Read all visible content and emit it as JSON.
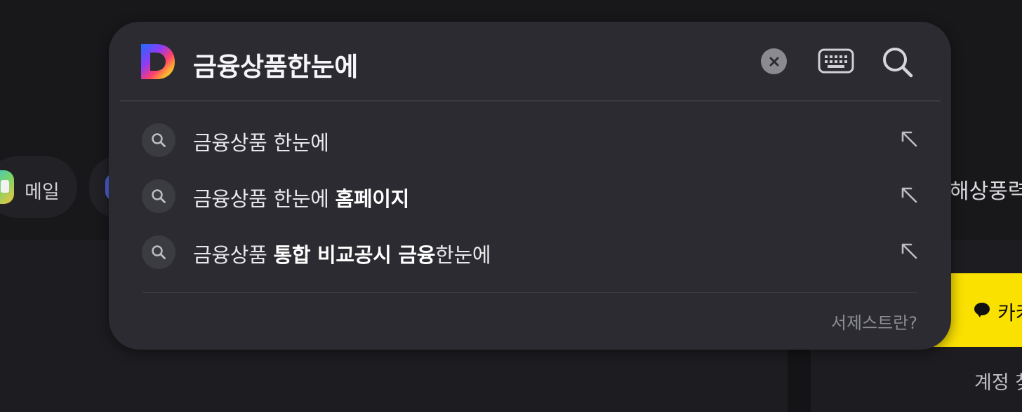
{
  "background": {
    "shortcuts": [
      {
        "label": "메일",
        "icon": "mail-app-icon"
      },
      {
        "label": "",
        "icon": "cafe-app-icon"
      }
    ],
    "right_heading": "해상풍력",
    "kakao_button_label": "카카",
    "account_label": "계정 찾"
  },
  "search": {
    "logo": "daum-logo-icon",
    "query": "금융상품한눈에",
    "clear_icon": "clear-icon",
    "keyboard_icon": "keyboard-icon",
    "search_icon": "search-icon",
    "suggestions": [
      {
        "normal_prefix": "금융상품 한눈에",
        "bold": "",
        "normal_suffix": ""
      },
      {
        "normal_prefix": "금융상품 한눈에 ",
        "bold": "홈페이지",
        "normal_suffix": ""
      },
      {
        "normal_prefix": "금융상품 ",
        "bold": "통합 비교공시 금융",
        "normal_suffix": "한눈에"
      }
    ],
    "help_link": "서제스트란?"
  },
  "colors": {
    "panel_bg": "#2b2b31",
    "page_bg": "#141417",
    "kakao_yellow": "#fae100"
  }
}
